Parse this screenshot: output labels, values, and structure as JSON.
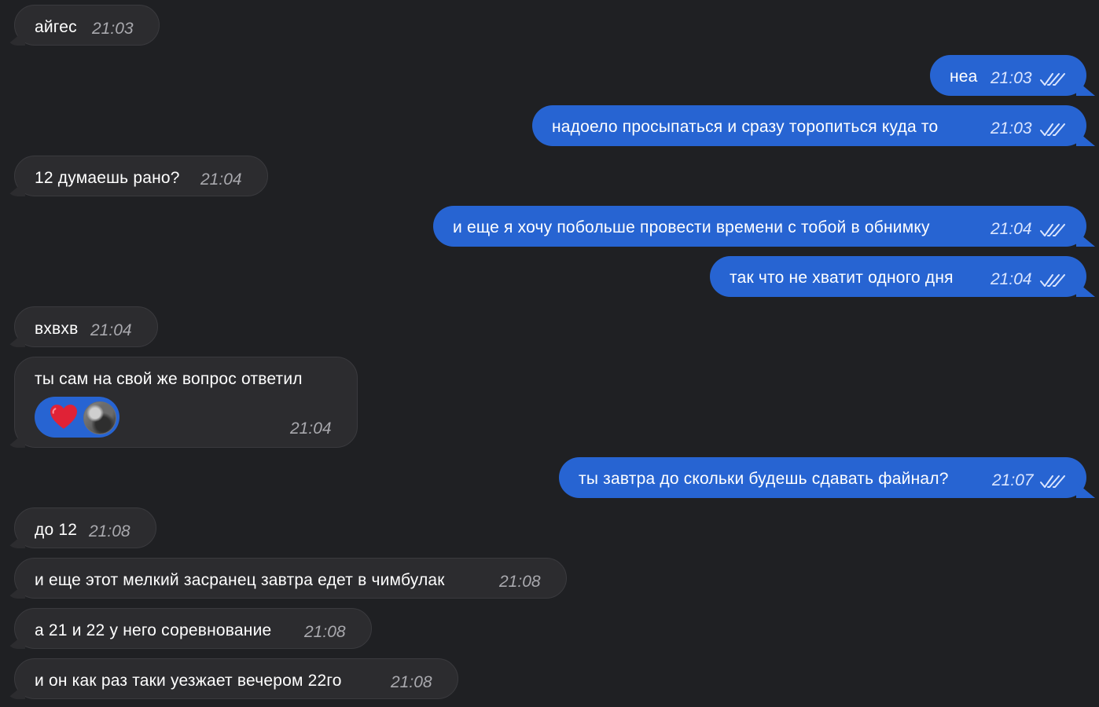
{
  "messages": [
    {
      "dir": "in",
      "text": "айгес",
      "time": "21:03"
    },
    {
      "dir": "out",
      "text": "неа",
      "time": "21:03"
    },
    {
      "dir": "out",
      "text": "надоело просыпаться и сразу торопиться куда то",
      "time": "21:03"
    },
    {
      "dir": "in",
      "text": "12 думаешь рано?",
      "time": "21:04"
    },
    {
      "dir": "out",
      "text": "и еще я хочу побольше провести времени с тобой в обнимку",
      "time": "21:04"
    },
    {
      "dir": "out",
      "text": "так что не хватит одного дня",
      "time": "21:04"
    },
    {
      "dir": "in",
      "text": "вхвхв",
      "time": "21:04"
    },
    {
      "dir": "in",
      "text": "ты сам на свой же вопрос ответил",
      "time": "21:04",
      "reaction": "heart-icon"
    },
    {
      "dir": "out",
      "text": "ты завтра до скольки будешь сдавать файнал?",
      "time": "21:07"
    },
    {
      "dir": "in",
      "text": "до 12",
      "time": "21:08"
    },
    {
      "dir": "in",
      "text": "и еще этот мелкий засранец завтра едет в чимбулак",
      "time": "21:08"
    },
    {
      "dir": "in",
      "text": "а 21 и 22 у него соревнование",
      "time": "21:08"
    },
    {
      "dir": "in",
      "text": "и он как раз таки уезжает вечером 22го",
      "time": "21:08"
    }
  ],
  "colors": {
    "background": "#1f2023",
    "incoming": "#2c2c2f",
    "outgoing": "#2764d2"
  },
  "icons": {
    "read_receipt": "double-check-icon",
    "reaction": "heart-icon",
    "reactor": "avatar"
  }
}
